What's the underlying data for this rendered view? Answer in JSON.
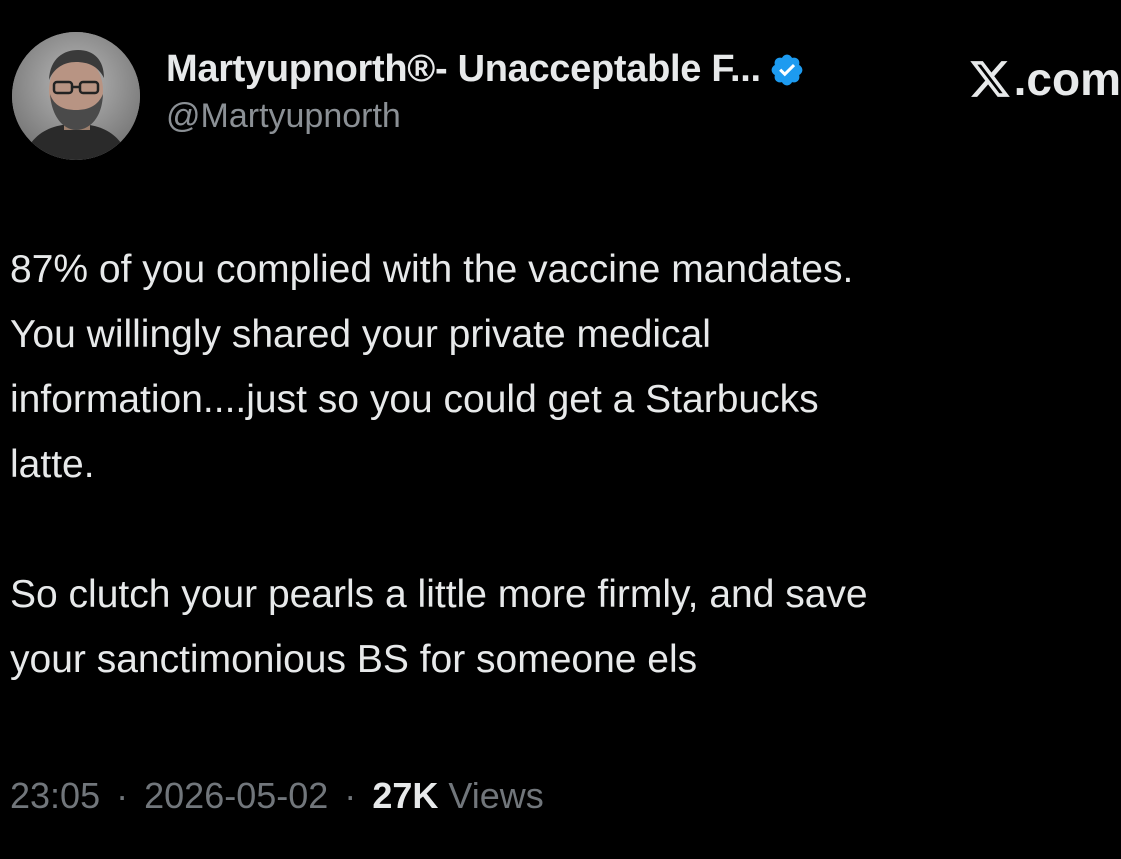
{
  "author": {
    "display_name": "Martyupnorth®- Unacceptable F...",
    "handle": "@Martyupnorth",
    "verified_icon": "verified-badge-icon",
    "avatar_icon": "profile-photo"
  },
  "brand": {
    "label": ".com",
    "icon": "x-logo-icon"
  },
  "tweet": {
    "paragraph_1": "87% of you complied with the vaccine mandates.\nYou willingly shared your private medical\ninformation....just so you could get a Starbucks\nlatte.",
    "paragraph_2": "So clutch your pearls a little more firmly, and save\nyour sanctimonious BS for someone els"
  },
  "meta": {
    "time": "23:05",
    "separator": "·",
    "date": "2026-05-02",
    "views_count": "27K",
    "views_label": "Views"
  },
  "colors": {
    "background": "#000000",
    "primary_text": "#e7e9ea",
    "secondary_text": "#71767b",
    "verified_blue": "#1d9bf0"
  }
}
